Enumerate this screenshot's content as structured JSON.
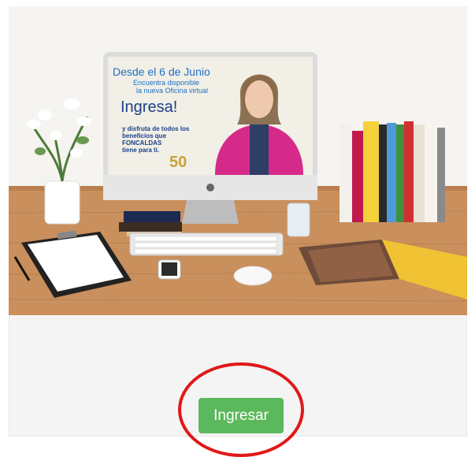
{
  "promo_screen": {
    "line1": "Desde el 6 de Junio",
    "line2": "Encuentra disponible",
    "line3": "la nueva Oficina virtual",
    "headline": "Ingresa!",
    "body1": "y disfruta de todos los",
    "body2": "beneficios que",
    "body3": "FONCALDAS",
    "body4": "tiene para ti.",
    "anniversary": "50"
  },
  "actions": {
    "ingresar_label": "Ingresar"
  },
  "colors": {
    "button": "#5cb85c",
    "highlight": "#e01818",
    "screen_accent": "#1f6fc5"
  }
}
